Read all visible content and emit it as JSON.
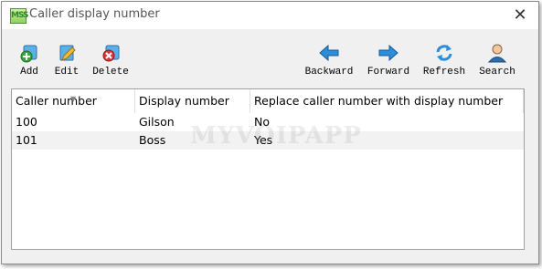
{
  "window": {
    "title": "Caller display number",
    "logo_text": "MSS"
  },
  "toolbar": {
    "add_label": "Add",
    "edit_label": "Edit",
    "delete_label": "Delete",
    "backward_label": "Backward",
    "forward_label": "Forward",
    "refresh_label": "Refresh",
    "search_label": "Search"
  },
  "table": {
    "columns": [
      "Caller number",
      "Display number",
      "Replace caller number with display number"
    ],
    "rows": [
      [
        "100",
        "Gilson",
        "No"
      ],
      [
        "101",
        "Boss",
        "Yes"
      ]
    ]
  },
  "watermark": "MYVOIPAPP",
  "colors": {
    "window_bg": "#f0f0f0",
    "alt_row": "#f2f2f2",
    "add_green": "#3aa83a",
    "delete_red": "#d83a3a",
    "nav_blue": "#2a8fd8"
  }
}
